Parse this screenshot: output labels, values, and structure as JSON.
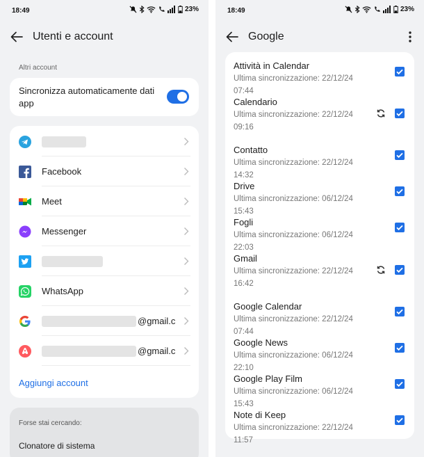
{
  "status": {
    "time": "18:49",
    "battery": "23%"
  },
  "left": {
    "title": "Utenti e account",
    "section_label": "Altri account",
    "sync_label": "Sincronizza automaticamente dati app",
    "sync_enabled": true,
    "apps": [
      {
        "label": "",
        "icon": "telegram-icon"
      },
      {
        "label": "Facebook",
        "icon": "facebook-icon"
      },
      {
        "label": "Meet",
        "icon": "google-meet-icon"
      },
      {
        "label": "Messenger",
        "icon": "messenger-icon"
      },
      {
        "label": "",
        "icon": "twitter-icon"
      },
      {
        "label": "WhatsApp",
        "icon": "whatsapp-icon"
      },
      {
        "label": "@gmail.c",
        "icon": "google-icon"
      },
      {
        "label": "@gmail.c",
        "icon": "airbnb-icon"
      }
    ],
    "add_account": "Aggiungi account",
    "search_label": "Forse stai cercando:",
    "search_item": "Clonatore di sistema"
  },
  "right": {
    "title": "Google",
    "items": [
      {
        "name": "Attività in Calendar",
        "sub": "Ultima sincronizzazione: 22/12/24 07:44",
        "syncing": false,
        "checked": true
      },
      {
        "name": "Calendario",
        "sub": "Ultima sincronizzazione: 22/12/24 09:16",
        "syncing": true,
        "checked": true
      },
      {
        "name": "Contatto",
        "sub": "Ultima sincronizzazione: 22/12/24 14:32",
        "syncing": false,
        "checked": true
      },
      {
        "name": "Drive",
        "sub": "Ultima sincronizzazione: 06/12/24 15:43",
        "syncing": false,
        "checked": true
      },
      {
        "name": "Fogli",
        "sub": "Ultima sincronizzazione: 06/12/24 22:03",
        "syncing": false,
        "checked": true
      },
      {
        "name": "Gmail",
        "sub": "Ultima sincronizzazione: 22/12/24 16:42",
        "syncing": true,
        "checked": true
      },
      {
        "name": "Google Calendar",
        "sub": "Ultima sincronizzazione: 22/12/24 07:44",
        "syncing": false,
        "checked": true
      },
      {
        "name": "Google News",
        "sub": "Ultima sincronizzazione: 06/12/24 22:10",
        "syncing": false,
        "checked": true
      },
      {
        "name": "Google Play Film",
        "sub": "Ultima sincronizzazione: 06/12/24 15:43",
        "syncing": false,
        "checked": true
      },
      {
        "name": "Note di Keep",
        "sub": "Ultima sincronizzazione: 22/12/24 11:57",
        "syncing": false,
        "checked": true
      }
    ]
  },
  "colors": {
    "accent": "#1f6fe5",
    "background": "#f1f2f4",
    "card": "#ffffff"
  }
}
